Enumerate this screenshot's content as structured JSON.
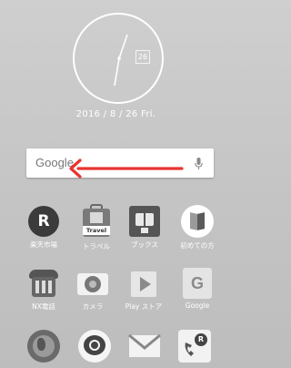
{
  "clock_widget": {
    "day_badge": "26",
    "date_label": "2016 / 8 / 26 Fri."
  },
  "search_bar": {
    "brand": "Google",
    "icon": "mic-icon"
  },
  "gesture_hint": {
    "icon": "left-arrow-icon",
    "color": "#e8342f"
  },
  "apps_row1": [
    {
      "label": "楽天市場",
      "icon": "rakuten-icon"
    },
    {
      "label": "トラベル",
      "icon": "travel-suitcase-icon",
      "badge": "Travel"
    },
    {
      "label": "ブックス",
      "icon": "books-icon"
    },
    {
      "label": "初めての方",
      "icon": "guide-book-icon"
    }
  ],
  "apps_row2": [
    {
      "label": "NX電話",
      "icon": "phone-keypad-icon"
    },
    {
      "label": "カメラ",
      "icon": "camera-icon"
    },
    {
      "label": "Play ストア",
      "icon": "play-store-icon"
    },
    {
      "label": "Google",
      "icon": "google-app-icon"
    }
  ],
  "apps_row3": [
    {
      "label": "",
      "icon": "globe-browser-icon"
    },
    {
      "label": "",
      "icon": "viber-icon"
    },
    {
      "label": "",
      "icon": "mail-icon"
    },
    {
      "label": "",
      "icon": "rakuten-link-icon"
    }
  ]
}
